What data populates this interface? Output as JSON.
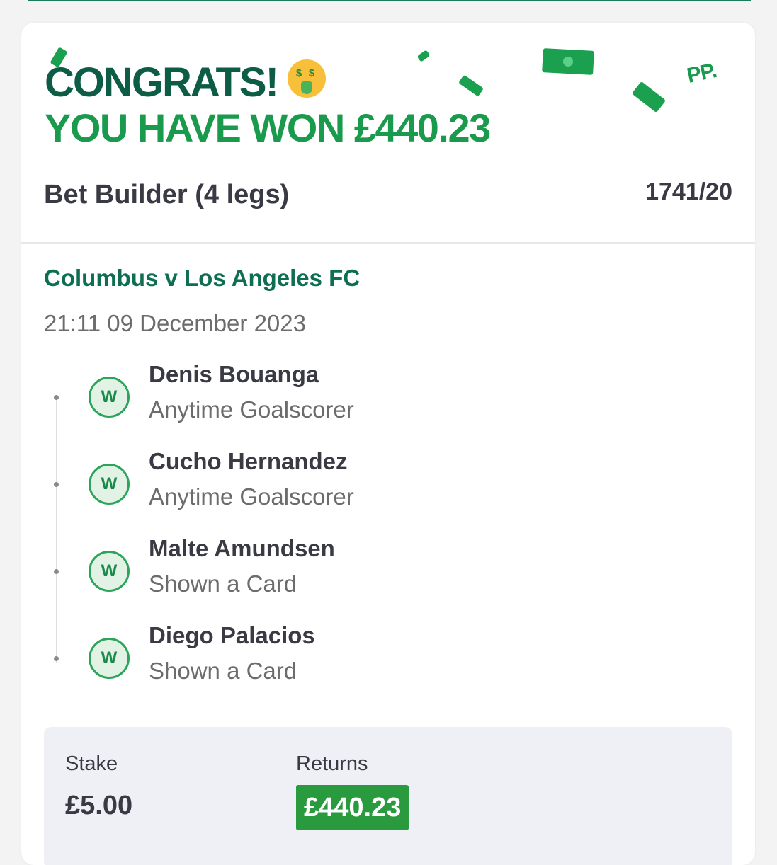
{
  "header": {
    "congrats_text": "CONGRATS!",
    "won_text": "YOU HAVE WON £440.23",
    "emoji_icon": "money-mouth-face-icon",
    "brand_logo_text": "PP.",
    "colors": {
      "dark_green": "#0d5c46",
      "bright_green": "#1a9a4c"
    }
  },
  "bet": {
    "type": "Bet Builder (4 legs)",
    "odds": "1741/20",
    "event": "Columbus v Los Angeles FC",
    "datetime": "21:11 09 December 2023",
    "legs": [
      {
        "status": "W",
        "selection": "Denis Bouanga",
        "market": "Anytime Goalscorer"
      },
      {
        "status": "W",
        "selection": "Cucho Hernandez",
        "market": "Anytime Goalscorer"
      },
      {
        "status": "W",
        "selection": "Malte Amundsen",
        "market": "Shown a Card"
      },
      {
        "status": "W",
        "selection": "Diego Palacios",
        "market": "Shown a Card"
      }
    ]
  },
  "summary": {
    "stake_label": "Stake",
    "stake_value": "£5.00",
    "returns_label": "Returns",
    "returns_value": "£440.23",
    "returns_color": "#2a9a3f"
  }
}
